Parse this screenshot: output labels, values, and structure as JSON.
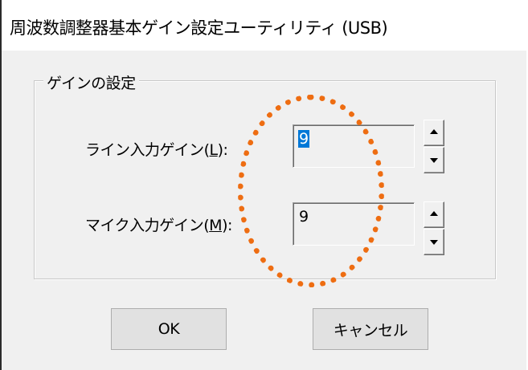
{
  "window": {
    "title": "周波数調整器基本ゲイン設定ユーティリティ (USB)"
  },
  "group": {
    "legend": "ゲインの設定"
  },
  "line_gain": {
    "label_prefix": "ライン入力ゲイン(",
    "mnemonic": "L",
    "label_suffix": "):",
    "value": "9"
  },
  "mic_gain": {
    "label_prefix": "マイク入力ゲイン(",
    "mnemonic": "M",
    "label_suffix": "):",
    "value": "9"
  },
  "buttons": {
    "ok_label": "OK",
    "cancel_label": "キャンセル"
  },
  "annotation": {
    "color": "#ee6d12",
    "shape": "dotted-ellipse"
  },
  "icons": {
    "spin_up": "triangle-up-icon",
    "spin_down": "triangle-down-icon"
  }
}
